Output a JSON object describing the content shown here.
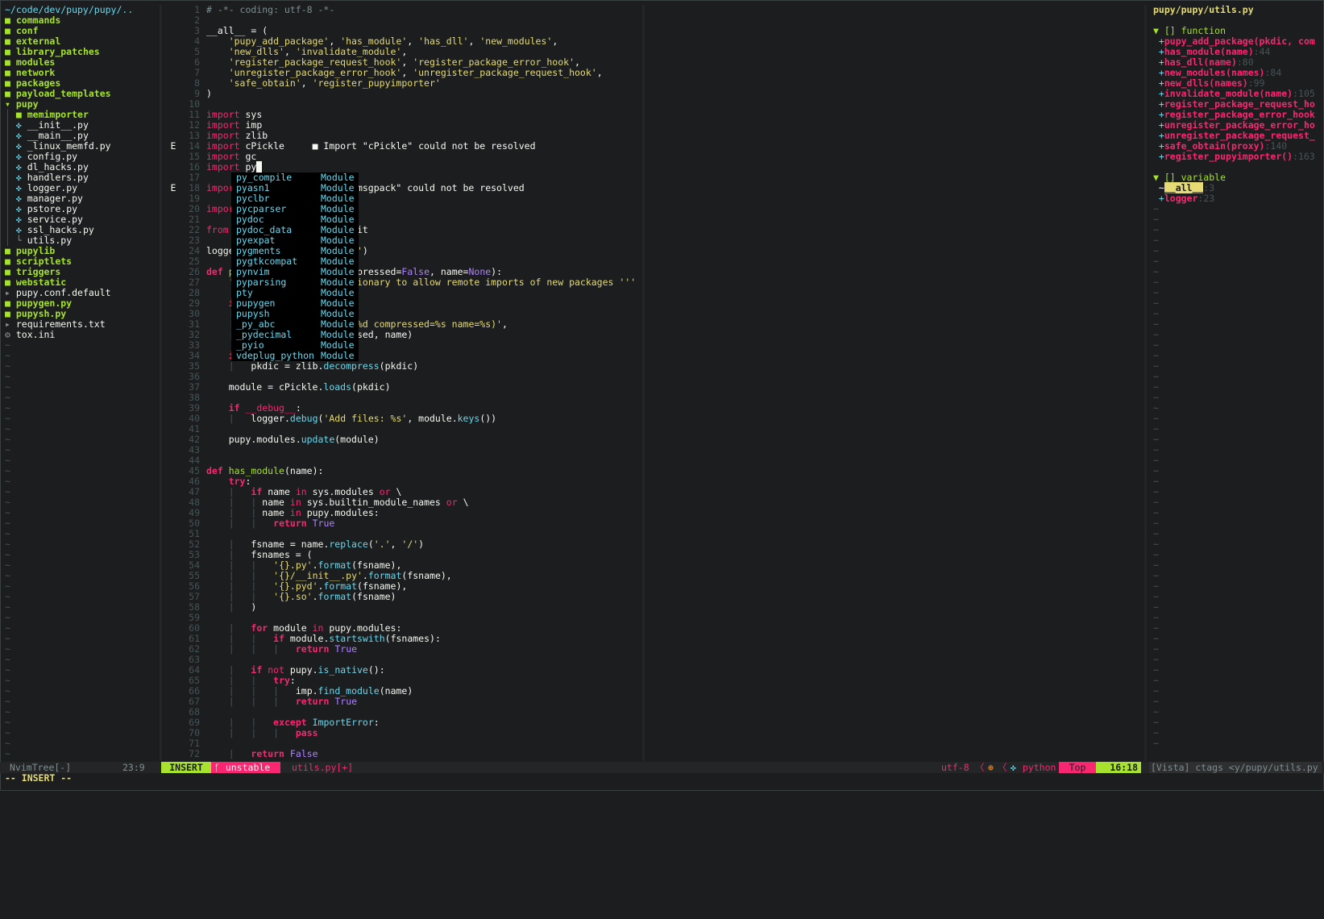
{
  "tree": {
    "root": "~/code/dev/pupy/pupy/..",
    "rows": [
      {
        "icon": "■",
        "label": "commands",
        "kind": "dir",
        "indent": 1
      },
      {
        "icon": "■",
        "label": "conf",
        "kind": "dir",
        "indent": 1
      },
      {
        "icon": "■",
        "label": "external",
        "kind": "dir",
        "indent": 1
      },
      {
        "icon": "■",
        "label": "library_patches",
        "kind": "dir",
        "indent": 1
      },
      {
        "icon": "■",
        "label": "modules",
        "kind": "dir",
        "indent": 1
      },
      {
        "icon": "■",
        "label": "network",
        "kind": "dir",
        "indent": 1
      },
      {
        "icon": "■",
        "label": "packages",
        "kind": "dir",
        "indent": 1
      },
      {
        "icon": "■",
        "label": "payload_templates",
        "kind": "dir",
        "indent": 1
      },
      {
        "icon": "▾",
        "label": "pupy",
        "kind": "dir",
        "indent": 1
      },
      {
        "icon": "■",
        "label": "memimporter",
        "kind": "dir",
        "indent": 2
      },
      {
        "icon": "✜",
        "label": "__init__.py",
        "kind": "file",
        "indent": 2
      },
      {
        "icon": "✜",
        "label": "__main__.py",
        "kind": "file",
        "indent": 2
      },
      {
        "icon": "✜",
        "label": "_linux_memfd.py",
        "kind": "file",
        "indent": 2
      },
      {
        "icon": "✜",
        "label": "config.py",
        "kind": "file",
        "indent": 2
      },
      {
        "icon": "✜",
        "label": "dl_hacks.py",
        "kind": "file",
        "indent": 2
      },
      {
        "icon": "✜",
        "label": "handlers.py",
        "kind": "file",
        "indent": 2
      },
      {
        "icon": "✜",
        "label": "logger.py",
        "kind": "file",
        "indent": 2
      },
      {
        "icon": "✜",
        "label": "manager.py",
        "kind": "file",
        "indent": 2
      },
      {
        "icon": "✜",
        "label": "pstore.py",
        "kind": "file",
        "indent": 2
      },
      {
        "icon": "✜",
        "label": "service.py",
        "kind": "file",
        "indent": 2
      },
      {
        "icon": "✜",
        "label": "ssl_hacks.py",
        "kind": "file",
        "indent": 2
      },
      {
        "icon": "└",
        "label": "utils.py",
        "kind": "file",
        "indent": 2
      },
      {
        "icon": "■",
        "label": "pupylib",
        "kind": "dir",
        "indent": 1
      },
      {
        "icon": "■",
        "label": "scriptlets",
        "kind": "dir",
        "indent": 1
      },
      {
        "icon": "■",
        "label": "triggers",
        "kind": "dir",
        "indent": 1
      },
      {
        "icon": "■",
        "label": "webstatic",
        "kind": "dir",
        "indent": 1
      },
      {
        "icon": "▸",
        "label": "pupy.conf.default",
        "kind": "file",
        "indent": 1
      },
      {
        "icon": "■",
        "label": "pupygen.py",
        "kind": "dirfile",
        "indent": 1
      },
      {
        "icon": "■",
        "label": "pupysh.py",
        "kind": "dirfile",
        "indent": 1
      },
      {
        "icon": "▸",
        "label": "requirements.txt",
        "kind": "file",
        "indent": 1
      },
      {
        "icon": "⚙",
        "label": "tox.ini",
        "kind": "file",
        "indent": 1
      }
    ]
  },
  "editor": {
    "lines": [
      {
        "n": "1",
        "sign": "",
        "html": "<span class='cm'># -*- coding: utf-8 -*-</span>"
      },
      {
        "n": "2",
        "sign": "",
        "html": ""
      },
      {
        "n": "3",
        "sign": "",
        "html": "__all__ = ("
      },
      {
        "n": "4",
        "sign": "",
        "html": "    <span class='str'>'pupy_add_package'</span>, <span class='str'>'has_module'</span>, <span class='str'>'has_dll'</span>, <span class='str'>'new_modules'</span>,"
      },
      {
        "n": "5",
        "sign": "",
        "html": "    <span class='str'>'new_dlls'</span>, <span class='str'>'invalidate_module'</span>,"
      },
      {
        "n": "6",
        "sign": "",
        "html": "    <span class='str'>'register_package_request_hook'</span>, <span class='str'>'register_package_error_hook'</span>,"
      },
      {
        "n": "7",
        "sign": "",
        "html": "    <span class='str'>'unregister_package_error_hook'</span>, <span class='str'>'unregister_package_request_hook'</span>,"
      },
      {
        "n": "8",
        "sign": "",
        "html": "    <span class='str'>'safe_obtain'</span>, <span class='str'>'register_pupyimporter'</span>"
      },
      {
        "n": "9",
        "sign": "",
        "html": ")"
      },
      {
        "n": "10",
        "sign": "",
        "html": ""
      },
      {
        "n": "11",
        "sign": "",
        "html": "<span class='kw2'>import</span> sys"
      },
      {
        "n": "12",
        "sign": "",
        "html": "<span class='kw2'>import</span> imp"
      },
      {
        "n": "13",
        "sign": "",
        "html": "<span class='kw2'>import</span> zlib"
      },
      {
        "n": "14",
        "sign": "E",
        "html": "<span class='kw2'>import</span> cPickle     <span class='diag'>■ Import \"cPickle\" could not be resolved</span>"
      },
      {
        "n": "15",
        "sign": "",
        "html": "<span class='kw2'>import</span> gc"
      },
      {
        "n": "16",
        "sign": "",
        "html": "<span class='kw2'>import</span> py<span class='cursor'> </span>"
      },
      {
        "n": "17",
        "sign": "",
        "html": ""
      },
      {
        "n": "18",
        "sign": "E",
        "html": "<span class='kw2'>import</span>                   <span class='diag'>\"umsgpack\" could not be resolved</span>"
      },
      {
        "n": "19",
        "sign": "",
        "html": ""
      },
      {
        "n": "20",
        "sign": "",
        "html": "<span class='kw2'>import</span>"
      },
      {
        "n": "21",
        "sign": "",
        "html": ""
      },
      {
        "n": "22",
        "sign": "",
        "html": "<span class='kw2'>from</span> n                  owait"
      },
      {
        "n": "23",
        "sign": "",
        "html": ""
      },
      {
        "n": "24",
        "sign": "",
        "html": "logger                   <span class='str'>ls'</span>)"
      },
      {
        "n": "25",
        "sign": "",
        "html": ""
      },
      {
        "n": "26",
        "sign": "",
        "html": "<span class='kw'>def</span> <span class='fn'>pu</span>                   ompressed=<span class='con'>False</span>, name=<span class='con'>None</span>):"
      },
      {
        "n": "27",
        "sign": "",
        "html": "    <span class='str'>''</span>                   <span class='str'>ctionary to allow remote imports of new packages '''</span>"
      },
      {
        "n": "28",
        "sign": "",
        "html": ""
      },
      {
        "n": "29",
        "sign": "",
        "html": "    <span class='kw'>if</span>"
      },
      {
        "n": "30",
        "sign": "",
        "html": "    <span class='guide'>|</span>"
      },
      {
        "n": "31",
        "sign": "",
        "html": "    <span class='guide'>|</span>                    <span class='str'>e=%d compressed=%s name=%s)'</span>,"
      },
      {
        "n": "32",
        "sign": "",
        "html": "    <span class='guide'>|</span>                    essed, name)"
      },
      {
        "n": "33",
        "sign": "",
        "html": ""
      },
      {
        "n": "34",
        "sign": "",
        "html": "    <span class='kw'>if</span>"
      },
      {
        "n": "35",
        "sign": "",
        "html": "    <span class='guide'>|</span>   pkdic = zlib.<span class='bi'>decompress</span>(pkdic)"
      },
      {
        "n": "36",
        "sign": "",
        "html": ""
      },
      {
        "n": "37",
        "sign": "",
        "html": "    module = cPickle.<span class='bi'>loads</span>(pkdic)"
      },
      {
        "n": "38",
        "sign": "",
        "html": ""
      },
      {
        "n": "39",
        "sign": "",
        "html": "    <span class='kw'>if</span> <span class='kw2'>__debug__</span>:"
      },
      {
        "n": "40",
        "sign": "",
        "html": "    <span class='guide'>|</span>   logger.<span class='bi'>debug</span>(<span class='str'>'Add files: %s'</span>, module.<span class='bi'>keys</span>())"
      },
      {
        "n": "41",
        "sign": "",
        "html": ""
      },
      {
        "n": "42",
        "sign": "",
        "html": "    pupy.modules.<span class='bi'>update</span>(module)"
      },
      {
        "n": "43",
        "sign": "",
        "html": ""
      },
      {
        "n": "44",
        "sign": "",
        "html": ""
      },
      {
        "n": "45",
        "sign": "",
        "html": "<span class='kw'>def</span> <span class='fn'>has_module</span>(name):"
      },
      {
        "n": "46",
        "sign": "",
        "html": "    <span class='kw'>try</span>:"
      },
      {
        "n": "47",
        "sign": "",
        "html": "    <span class='guide'>|</span>   <span class='kw'>if</span> name <span class='kw2'>in</span> sys.modules <span class='kw2'>or</span> \\"
      },
      {
        "n": "48",
        "sign": "",
        "html": "    <span class='guide'>|</span>   <span class='guide'>|</span> name <span class='kw2'>in</span> sys.builtin_module_names <span class='kw2'>or</span> \\"
      },
      {
        "n": "49",
        "sign": "",
        "html": "    <span class='guide'>|</span>   <span class='guide'>|</span> name <span class='kw2'>in</span> pupy.modules:"
      },
      {
        "n": "50",
        "sign": "",
        "html": "    <span class='guide'>|</span>   <span class='guide'>|</span>   <span class='kw'>return</span> <span class='con'>True</span>"
      },
      {
        "n": "51",
        "sign": "",
        "html": ""
      },
      {
        "n": "52",
        "sign": "",
        "html": "    <span class='guide'>|</span>   fsname = name.<span class='bi'>replace</span>(<span class='str'>'.'</span>, <span class='str'>'/'</span>)"
      },
      {
        "n": "53",
        "sign": "",
        "html": "    <span class='guide'>|</span>   fsnames = ("
      },
      {
        "n": "54",
        "sign": "",
        "html": "    <span class='guide'>|</span>   <span class='guide'>|</span>   <span class='str'>'{}.py'</span>.<span class='bi'>format</span>(fsname),"
      },
      {
        "n": "55",
        "sign": "",
        "html": "    <span class='guide'>|</span>   <span class='guide'>|</span>   <span class='str'>'{}/__init__.py'</span>.<span class='bi'>format</span>(fsname),"
      },
      {
        "n": "56",
        "sign": "",
        "html": "    <span class='guide'>|</span>   <span class='guide'>|</span>   <span class='str'>'{}.pyd'</span>.<span class='bi'>format</span>(fsname),"
      },
      {
        "n": "57",
        "sign": "",
        "html": "    <span class='guide'>|</span>   <span class='guide'>|</span>   <span class='str'>'{}.so'</span>.<span class='bi'>format</span>(fsname)"
      },
      {
        "n": "58",
        "sign": "",
        "html": "    <span class='guide'>|</span>   )"
      },
      {
        "n": "59",
        "sign": "",
        "html": ""
      },
      {
        "n": "60",
        "sign": "",
        "html": "    <span class='guide'>|</span>   <span class='kw'>for</span> module <span class='kw2'>in</span> pupy.modules:"
      },
      {
        "n": "61",
        "sign": "",
        "html": "    <span class='guide'>|</span>   <span class='guide'>|</span>   <span class='kw'>if</span> module.<span class='bi'>startswith</span>(fsnames):"
      },
      {
        "n": "62",
        "sign": "",
        "html": "    <span class='guide'>|</span>   <span class='guide'>|</span>   <span class='guide'>|</span>   <span class='kw'>return</span> <span class='con'>True</span>"
      },
      {
        "n": "63",
        "sign": "",
        "html": ""
      },
      {
        "n": "64",
        "sign": "",
        "html": "    <span class='guide'>|</span>   <span class='kw'>if</span> <span class='kw2'>not</span> pupy.<span class='bi'>is_native</span>():"
      },
      {
        "n": "65",
        "sign": "",
        "html": "    <span class='guide'>|</span>   <span class='guide'>|</span>   <span class='kw'>try</span>:"
      },
      {
        "n": "66",
        "sign": "",
        "html": "    <span class='guide'>|</span>   <span class='guide'>|</span>   <span class='guide'>|</span>   imp.<span class='bi'>find_module</span>(name)"
      },
      {
        "n": "67",
        "sign": "",
        "html": "    <span class='guide'>|</span>   <span class='guide'>|</span>   <span class='guide'>|</span>   <span class='kw'>return</span> <span class='con'>True</span>"
      },
      {
        "n": "68",
        "sign": "",
        "html": ""
      },
      {
        "n": "69",
        "sign": "",
        "html": "    <span class='guide'>|</span>   <span class='guide'>|</span>   <span class='kw'>except</span> <span class='bi'>ImportError</span>:"
      },
      {
        "n": "70",
        "sign": "",
        "html": "    <span class='guide'>|</span>   <span class='guide'>|</span>   <span class='guide'>|</span>   <span class='kw'>pass</span>"
      },
      {
        "n": "71",
        "sign": "",
        "html": ""
      },
      {
        "n": "72",
        "sign": "",
        "html": "    <span class='guide'>|</span>   <span class='kw'>return</span> <span class='con'>False</span>"
      }
    ]
  },
  "popup": {
    "items": [
      {
        "name": "py_compile",
        "kind": "Module"
      },
      {
        "name": "pyasn1",
        "kind": "Module"
      },
      {
        "name": "pyclbr",
        "kind": "Module"
      },
      {
        "name": "pycparser",
        "kind": "Module"
      },
      {
        "name": "pydoc",
        "kind": "Module"
      },
      {
        "name": "pydoc_data",
        "kind": "Module"
      },
      {
        "name": "pyexpat",
        "kind": "Module"
      },
      {
        "name": "pygments",
        "kind": "Module"
      },
      {
        "name": "pygtkcompat",
        "kind": "Module"
      },
      {
        "name": "pynvim",
        "kind": "Module"
      },
      {
        "name": "pyparsing",
        "kind": "Module"
      },
      {
        "name": "pty",
        "kind": "Module"
      },
      {
        "name": "pupygen",
        "kind": "Module"
      },
      {
        "name": "pupysh",
        "kind": "Module"
      },
      {
        "name": "_py_abc",
        "kind": "Module"
      },
      {
        "name": "_pydecimal",
        "kind": "Module"
      },
      {
        "name": "_pyio",
        "kind": "Module"
      },
      {
        "name": "vdeplug_python",
        "kind": "Module"
      }
    ]
  },
  "vista": {
    "title": "pupy/pupy/utils.py",
    "function_header": "▼ [] function",
    "functions": [
      {
        "name": "pupy_add_package(pkdic, com",
        "ln": ""
      },
      {
        "name": "has_module(name)",
        "ln": ":44"
      },
      {
        "name": "has_dll(name)",
        "ln": ":80"
      },
      {
        "name": "new_modules(names)",
        "ln": ":84"
      },
      {
        "name": "new_dlls(names)",
        "ln": ":99"
      },
      {
        "name": "invalidate_module(name)",
        "ln": ":105"
      },
      {
        "name": "register_package_request_ho",
        "ln": ""
      },
      {
        "name": "register_package_error_hook",
        "ln": ""
      },
      {
        "name": "unregister_package_error_ho",
        "ln": ""
      },
      {
        "name": "unregister_package_request_",
        "ln": ""
      },
      {
        "name": "safe_obtain(proxy)",
        "ln": ":140"
      },
      {
        "name": "register_pupyimporter()",
        "ln": ":163"
      }
    ],
    "variable_header": "▼ [] variable",
    "variables": [
      {
        "name": "__all__",
        "ln": ":3",
        "selected": true
      },
      {
        "name": "logger",
        "ln": ":23",
        "selected": false
      }
    ]
  },
  "status": {
    "tree_label": "NvimTree[-]",
    "tree_pos": "23:9",
    "mode": "INSERT",
    "branch": " unstable",
    "filename": "utils.py[+]",
    "encoding": "utf-8",
    "filetype": " python",
    "position_pct": "Top",
    "cursor_pos": "16:18",
    "vista_label": "[Vista] ctags <y/pupy/utils.py"
  },
  "cmdline": "-- INSERT --"
}
